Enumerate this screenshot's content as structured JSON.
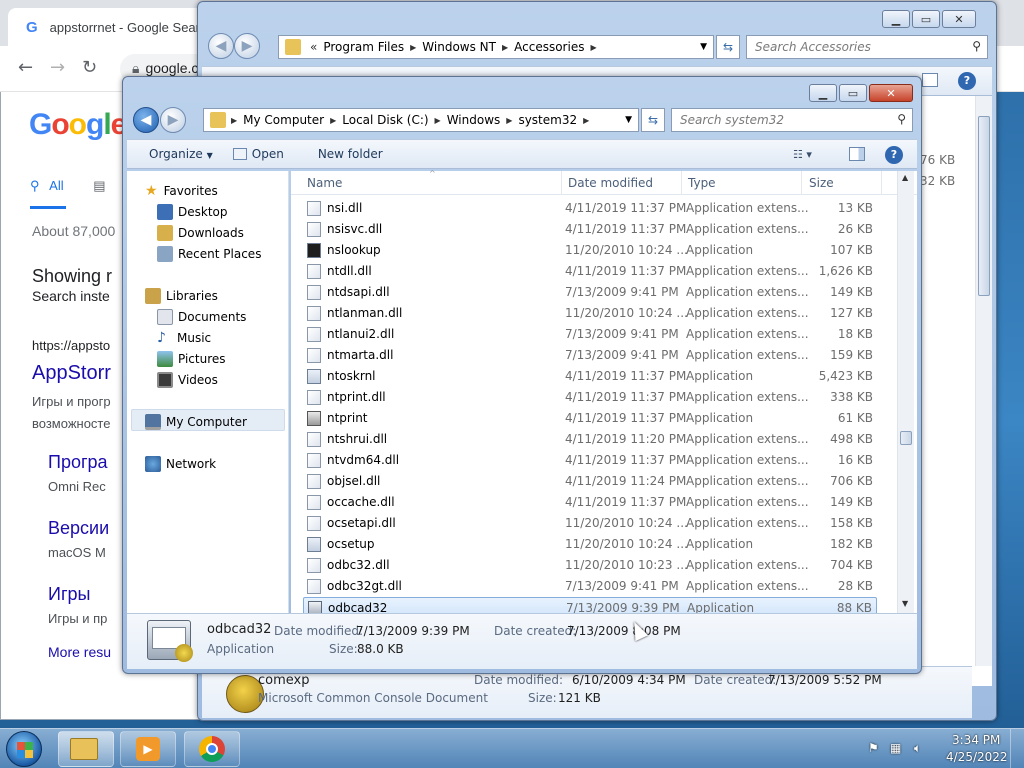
{
  "chrome": {
    "tab_title": "appstorrnet - Google Search",
    "omnibox_text": "google.c",
    "logo_letters": [
      "G",
      "o",
      "o",
      "g",
      "l",
      "e"
    ],
    "filter_all": "All",
    "result_count": "About 87,000",
    "showing": "Showing r",
    "search_instead": "Search inste",
    "url": "https://appsto",
    "result_title": "AppStorr",
    "snippet_1": "Игры и прогр",
    "snippet_2": "возможносте",
    "sub1_title": "Програ",
    "sub1_desc": "Omni Rec",
    "sub2_title": "Версии",
    "sub2_desc": "macOS M",
    "sub3_title": "Игры",
    "sub3_desc": "Игры и пр",
    "more": "More resu"
  },
  "back_window": {
    "breadcrumb": [
      "Program Files",
      "Windows NT",
      "Accessories"
    ],
    "chevron": "«",
    "search_placeholder": "Search Accessories",
    "size_1": "76 KB",
    "size_2": "32 KB",
    "details": {
      "name": "comexp",
      "type": "Microsoft Common Console Document",
      "modified_label": "Date modified:",
      "modified": "6/10/2009 4:34 PM",
      "created_label": "Date created:",
      "created": "7/13/2009 5:52 PM",
      "size_label": "Size:",
      "size": "121 KB"
    }
  },
  "front_window": {
    "breadcrumb": [
      "My Computer",
      "Local Disk (C:)",
      "Windows",
      "system32"
    ],
    "search_placeholder": "Search system32",
    "toolbar": {
      "organize": "Organize",
      "open": "Open",
      "new_folder": "New folder"
    },
    "nav": {
      "favorites": "Favorites",
      "desktop": "Desktop",
      "downloads": "Downloads",
      "recent": "Recent Places",
      "libraries": "Libraries",
      "documents": "Documents",
      "music": "Music",
      "pictures": "Pictures",
      "videos": "Videos",
      "computer": "My Computer",
      "network": "Network"
    },
    "columns": {
      "name": "Name",
      "date": "Date modified",
      "type": "Type",
      "size": "Size"
    },
    "files": [
      {
        "name": "nsi.dll",
        "date": "4/11/2019 11:37 PM",
        "type": "Application extens...",
        "size": "13 KB",
        "icon": "dll"
      },
      {
        "name": "nsisvc.dll",
        "date": "4/11/2019 11:37 PM",
        "type": "Application extens...",
        "size": "26 KB",
        "icon": "dll"
      },
      {
        "name": "nslookup",
        "date": "11/20/2010 10:24 ...",
        "type": "Application",
        "size": "107 KB",
        "icon": "exe-terminal"
      },
      {
        "name": "ntdll.dll",
        "date": "4/11/2019 11:37 PM",
        "type": "Application extens...",
        "size": "1,626 KB",
        "icon": "dll"
      },
      {
        "name": "ntdsapi.dll",
        "date": "7/13/2009 9:41 PM",
        "type": "Application extens...",
        "size": "149 KB",
        "icon": "dll"
      },
      {
        "name": "ntlanman.dll",
        "date": "11/20/2010 10:24 ...",
        "type": "Application extens...",
        "size": "127 KB",
        "icon": "dll"
      },
      {
        "name": "ntlanui2.dll",
        "date": "7/13/2009 9:41 PM",
        "type": "Application extens...",
        "size": "18 KB",
        "icon": "dll"
      },
      {
        "name": "ntmarta.dll",
        "date": "7/13/2009 9:41 PM",
        "type": "Application extens...",
        "size": "159 KB",
        "icon": "dll"
      },
      {
        "name": "ntoskrnl",
        "date": "4/11/2019 11:37 PM",
        "type": "Application",
        "size": "5,423 KB",
        "icon": "exe"
      },
      {
        "name": "ntprint.dll",
        "date": "4/11/2019 11:37 PM",
        "type": "Application extens...",
        "size": "338 KB",
        "icon": "dll"
      },
      {
        "name": "ntprint",
        "date": "4/11/2019 11:37 PM",
        "type": "Application",
        "size": "61 KB",
        "icon": "exe-printer"
      },
      {
        "name": "ntshrui.dll",
        "date": "4/11/2019 11:20 PM",
        "type": "Application extens...",
        "size": "498 KB",
        "icon": "dll"
      },
      {
        "name": "ntvdm64.dll",
        "date": "4/11/2019 11:37 PM",
        "type": "Application extens...",
        "size": "16 KB",
        "icon": "dll"
      },
      {
        "name": "objsel.dll",
        "date": "4/11/2019 11:24 PM",
        "type": "Application extens...",
        "size": "706 KB",
        "icon": "dll"
      },
      {
        "name": "occache.dll",
        "date": "4/11/2019 11:37 PM",
        "type": "Application extens...",
        "size": "149 KB",
        "icon": "dll"
      },
      {
        "name": "ocsetapi.dll",
        "date": "11/20/2010 10:24 ...",
        "type": "Application extens...",
        "size": "158 KB",
        "icon": "dll"
      },
      {
        "name": "ocsetup",
        "date": "11/20/2010 10:24 ...",
        "type": "Application",
        "size": "182 KB",
        "icon": "exe"
      },
      {
        "name": "odbc32.dll",
        "date": "11/20/2010 10:23 ...",
        "type": "Application extens...",
        "size": "704 KB",
        "icon": "dll"
      },
      {
        "name": "odbc32gt.dll",
        "date": "7/13/2009 9:41 PM",
        "type": "Application extens...",
        "size": "28 KB",
        "icon": "dll"
      },
      {
        "name": "odbcad32",
        "date": "7/13/2009 9:39 PM",
        "type": "Application",
        "size": "88 KB",
        "icon": "exe-odbc"
      }
    ],
    "selected_index": 19,
    "details": {
      "name": "odbcad32",
      "type": "Application",
      "modified_label": "Date modified:",
      "modified": "7/13/2009 9:39 PM",
      "created_label": "Date created:",
      "created": "7/13/2009 8:08 PM",
      "size_label": "Size:",
      "size": "88.0 KB"
    }
  },
  "taskbar": {
    "time": "3:34 PM",
    "date": "4/25/2022"
  },
  "colors": {
    "accent": "#1a73e8",
    "selection": "#d1e5fc",
    "close": "#c7432a"
  }
}
